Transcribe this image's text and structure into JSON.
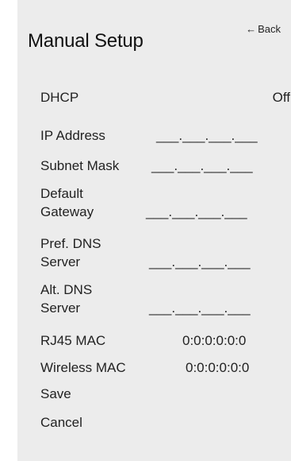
{
  "header": {
    "back_arrow": "←",
    "back_label": "Back",
    "title": "Manual Setup"
  },
  "rows": {
    "dhcp": {
      "label": "DHCP",
      "value": "Off"
    },
    "ip_address": {
      "label": "IP Address",
      "value": "___.___.___.___"
    },
    "subnet_mask": {
      "label": "Subnet Mask",
      "value": "___.___.___.___"
    },
    "default_gateway": {
      "label_line1": "Default",
      "label_line2": "Gateway",
      "value": "___.___.___.___"
    },
    "pref_dns": {
      "label_line1": "Pref. DNS",
      "label_line2": "Server",
      "value": "___.___.___.___"
    },
    "alt_dns": {
      "label_line1": "Alt. DNS",
      "label_line2": "Server",
      "value": "___.___.___.___"
    },
    "rj45_mac": {
      "label": "RJ45 MAC",
      "value": "0:0:0:0:0:0"
    },
    "wireless_mac": {
      "label": "Wireless MAC",
      "value": "0:0:0:0:0:0"
    }
  },
  "actions": {
    "save": "Save",
    "cancel": "Cancel"
  },
  "colors": {
    "panel_background": "#ececec",
    "text": "#222222"
  }
}
